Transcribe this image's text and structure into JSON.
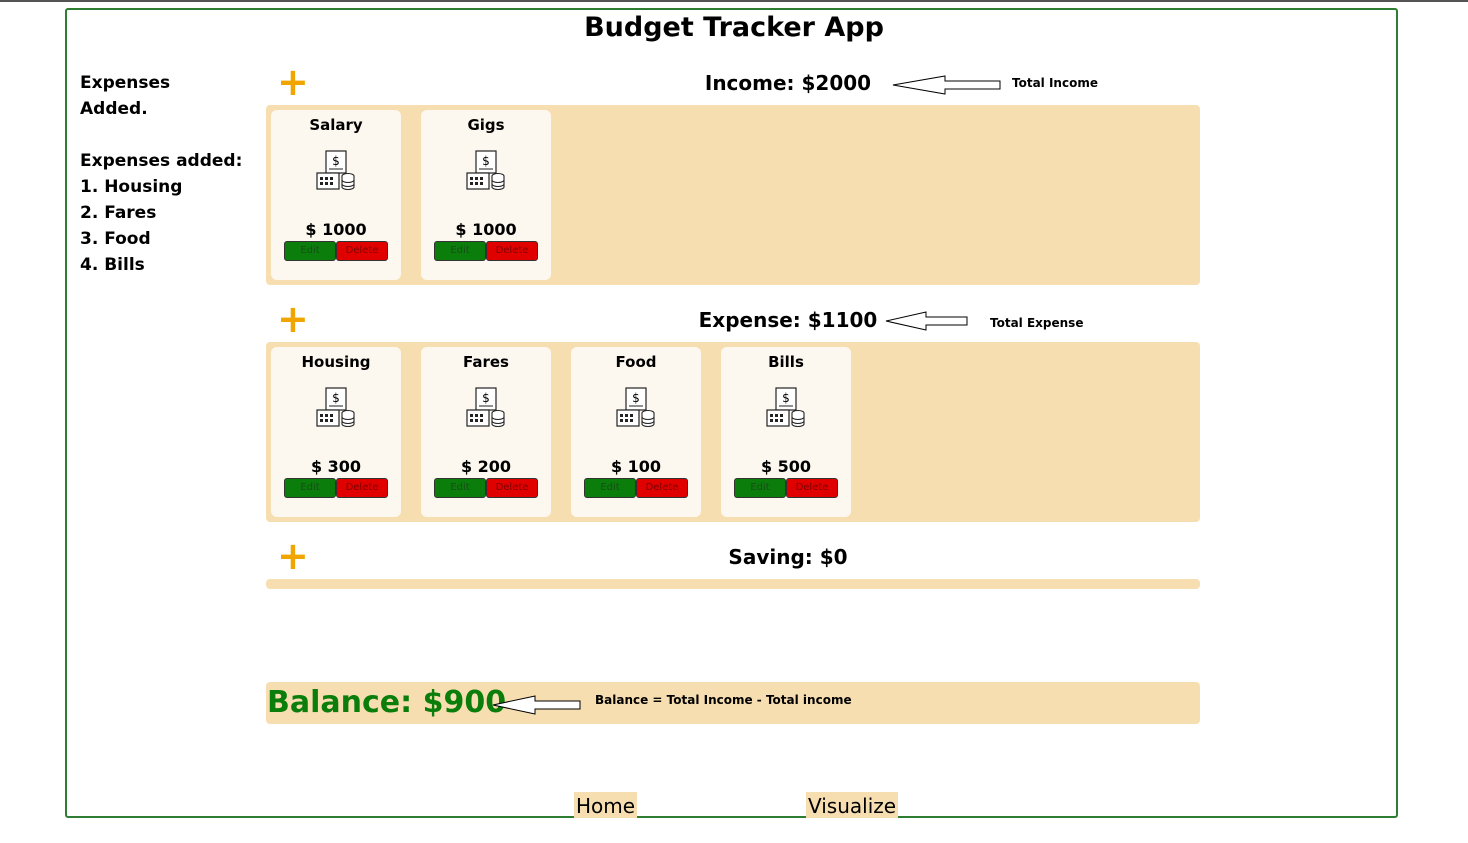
{
  "app": {
    "title": "Budget Tracker App"
  },
  "sidebar": {
    "note": "Expenses Added.",
    "list_heading": "Expenses added:",
    "items": [
      "1. Housing",
      "2. Fares",
      "3. Food",
      "4. Bills"
    ]
  },
  "income": {
    "heading": "Income: $2000",
    "callout": "Total Income",
    "add_icon": "+",
    "cards": [
      {
        "title": "Salary",
        "amount": "$ 1000",
        "edit": "Edit",
        "delete": "Delete",
        "icon": "cash-register-icon"
      },
      {
        "title": "Gigs",
        "amount": "$ 1000",
        "edit": "Edit",
        "delete": "Delete",
        "icon": "cash-register-icon"
      }
    ]
  },
  "expense": {
    "heading": "Expense: $1100",
    "callout": "Total Expense",
    "add_icon": "+",
    "cards": [
      {
        "title": "Housing",
        "amount": "$ 300",
        "edit": "Edit",
        "delete": "Delete",
        "icon": "cash-register-icon"
      },
      {
        "title": "Fares",
        "amount": "$ 200",
        "edit": "Edit",
        "delete": "Delete",
        "icon": "cash-register-icon"
      },
      {
        "title": "Food",
        "amount": "$ 100",
        "edit": "Edit",
        "delete": "Delete",
        "icon": "cash-register-icon"
      },
      {
        "title": "Bills",
        "amount": "$ 500",
        "edit": "Edit",
        "delete": "Delete",
        "icon": "cash-register-icon"
      }
    ]
  },
  "saving": {
    "heading": "Saving: $0",
    "add_icon": "+"
  },
  "balance": {
    "text": "Balance: $900",
    "callout": "Balance = Total Income - Total income"
  },
  "nav": {
    "home": "Home",
    "visualize": "Visualize"
  },
  "colors": {
    "frame": "#2e7d32",
    "panel": "#f7deb0",
    "card": "#fdf8ef",
    "plus": "#f0a500",
    "edit_button": "#0a7d0a",
    "delete_button": "#e10000",
    "balance_text": "#0a7d0a"
  }
}
